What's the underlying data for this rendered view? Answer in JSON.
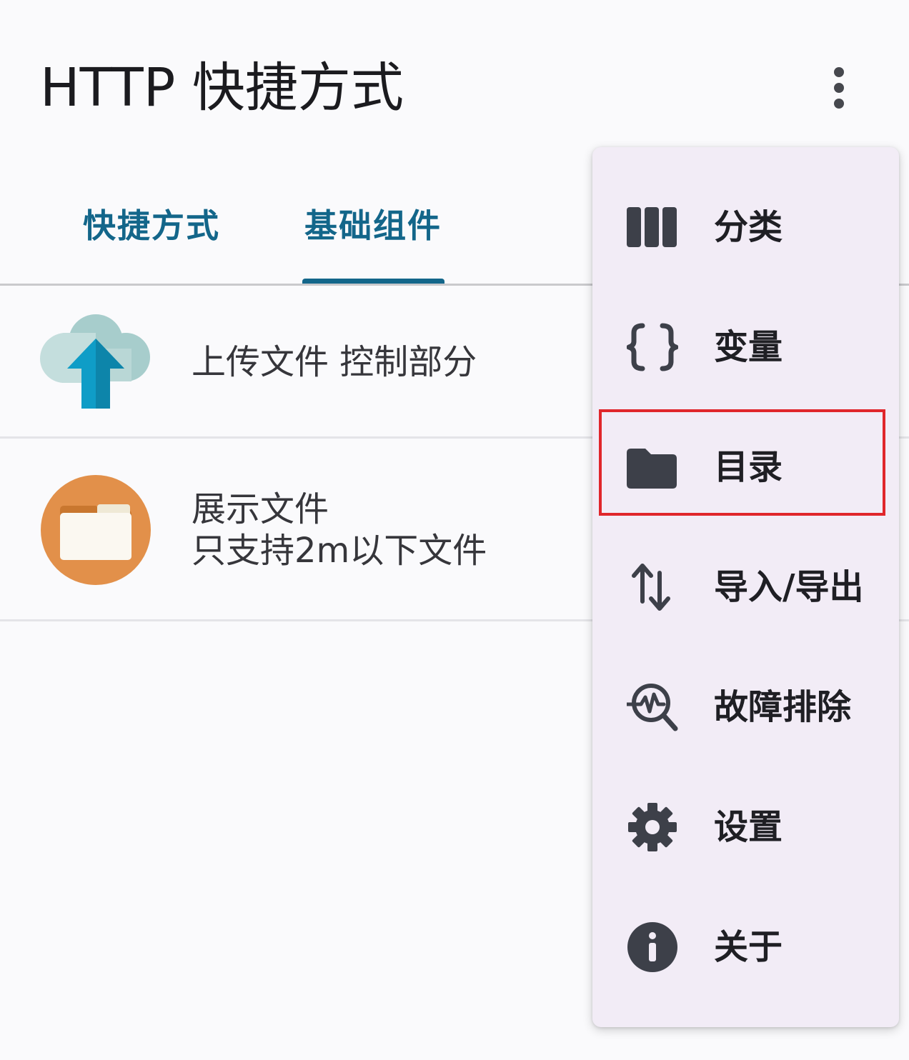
{
  "app_bar": {
    "title": "HTTP 快捷方式"
  },
  "tabs": [
    {
      "label": "快捷方式"
    },
    {
      "label": "基础组件"
    }
  ],
  "list_items": [
    {
      "title": "上传文件 控制部分",
      "icon": "cloud-upload-icon"
    },
    {
      "title": "展示文件",
      "subtitle": "只支持2m以下文件",
      "icon": "folder-icon"
    }
  ],
  "menu": {
    "items": [
      {
        "label": "分类",
        "icon": "columns-icon"
      },
      {
        "label": "变量",
        "icon": "braces-icon"
      },
      {
        "label": "目录",
        "icon": "folder-icon"
      },
      {
        "label": "导入/导出",
        "icon": "import-export-icon"
      },
      {
        "label": "故障排除",
        "icon": "troubleshoot-icon"
      },
      {
        "label": "设置",
        "icon": "gear-icon"
      },
      {
        "label": "关于",
        "icon": "info-icon"
      }
    ]
  },
  "colors": {
    "accent": "#13668a",
    "highlight": "#e0262b",
    "menu_bg": "#f2ecf6",
    "icon_dark": "#3d4049"
  }
}
